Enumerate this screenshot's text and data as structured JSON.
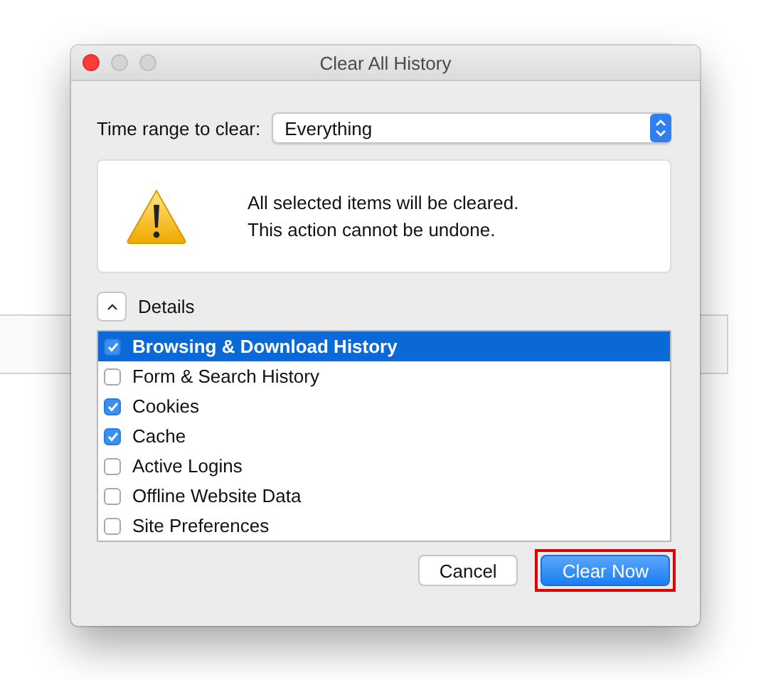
{
  "window": {
    "title": "Clear All History"
  },
  "time_range": {
    "label": "Time range to clear:",
    "value": "Everything"
  },
  "warning": {
    "lines": [
      "All selected items will be cleared.",
      "This action cannot be undone."
    ]
  },
  "details": {
    "label": "Details",
    "expanded": true
  },
  "items": [
    {
      "label": "Browsing & Download History",
      "checked": true,
      "selected": true
    },
    {
      "label": "Form & Search History",
      "checked": false,
      "selected": false
    },
    {
      "label": "Cookies",
      "checked": true,
      "selected": false
    },
    {
      "label": "Cache",
      "checked": true,
      "selected": false
    },
    {
      "label": "Active Logins",
      "checked": false,
      "selected": false
    },
    {
      "label": "Offline Website Data",
      "checked": false,
      "selected": false
    },
    {
      "label": "Site Preferences",
      "checked": false,
      "selected": false
    }
  ],
  "buttons": [
    {
      "label": "Cancel",
      "kind": "secondary",
      "highlighted": false
    },
    {
      "label": "Clear Now",
      "kind": "default",
      "highlighted": true
    }
  ]
}
